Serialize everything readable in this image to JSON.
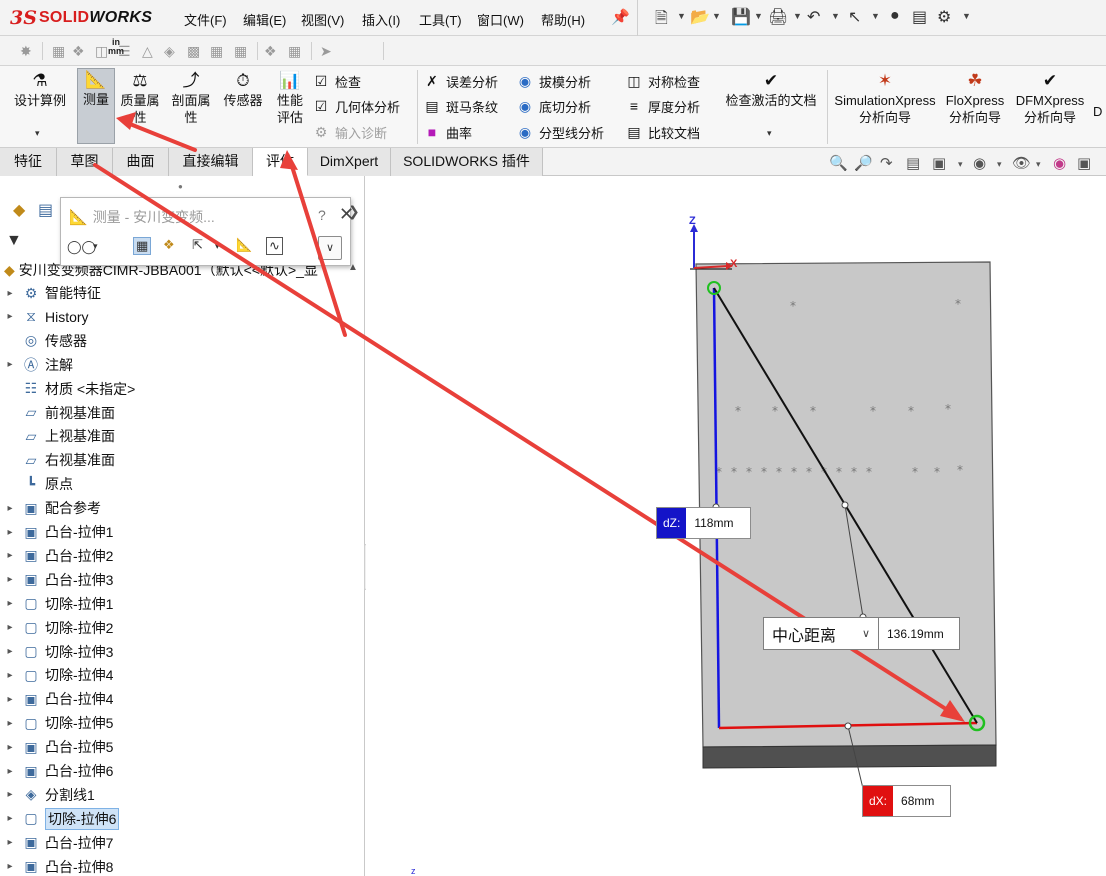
{
  "app": {
    "logo_prefix": "3S",
    "logo_solid": "SOLID",
    "logo_works": "WORKS"
  },
  "menu": [
    {
      "label": "文件(F)"
    },
    {
      "label": "编辑(E)"
    },
    {
      "label": "视图(V)"
    },
    {
      "label": "插入(I)"
    },
    {
      "label": "工具(T)"
    },
    {
      "label": "窗口(W)"
    },
    {
      "label": "帮助(H)"
    }
  ],
  "ribbon": {
    "design_study": "设计算例",
    "measure": "测量",
    "mass_props_line1": "质量属",
    "mass_props_line2": "性",
    "section_props_line1": "剖面属",
    "section_props_line2": "性",
    "sensor": "传感器",
    "perf_eval_line1": "性能",
    "perf_eval_line2": "评估",
    "check": "检查",
    "geometry_analysis": "几何体分析",
    "import_diagnostics": "输入诊断",
    "deviation_analysis": "误差分析",
    "zebra_stripes": "斑马条纹",
    "curvature": "曲率",
    "draft_analysis": "拔模分析",
    "undercut_analysis": "底切分析",
    "parting_line_analysis": "分型线分析",
    "symmetry_check": "对称检查",
    "thickness_analysis": "厚度分析",
    "compare_documents": "比较文档",
    "check_active_document": "检查激活的文档",
    "simxpress_line1": "SimulationXpress",
    "simxpress_line2": "分析向导",
    "floxpress_line1": "FloXpress",
    "floxpress_line2": "分析向导",
    "dfmxpress_line1": "DFMXpress",
    "dfmxpress_line2": "分析向导",
    "cut_off": "D"
  },
  "tabs": [
    {
      "label": "特征"
    },
    {
      "label": "草图"
    },
    {
      "label": "曲面"
    },
    {
      "label": "直接编辑"
    },
    {
      "label": "评估"
    },
    {
      "label": "DimXpert"
    },
    {
      "label": "SOLIDWORKS 插件"
    }
  ],
  "measure_popup": {
    "title": "测量 - 安川变变频...",
    "help": "?",
    "units_top": "in",
    "units_bottom": "mm"
  },
  "tree": {
    "root": "安川变变频器CIMR-JBBA001（默认<<默认>_显",
    "items": [
      {
        "label": "智能特征",
        "expandable": true
      },
      {
        "label": "History",
        "expandable": true
      },
      {
        "label": "传感器",
        "expandable": false
      },
      {
        "label": "注解",
        "expandable": true
      },
      {
        "label": "材质 <未指定>",
        "expandable": false
      },
      {
        "label": "前视基准面",
        "expandable": false
      },
      {
        "label": "上视基准面",
        "expandable": false
      },
      {
        "label": "右视基准面",
        "expandable": false
      },
      {
        "label": "原点",
        "expandable": false
      },
      {
        "label": "配合参考",
        "expandable": true
      },
      {
        "label": "凸台-拉伸1",
        "expandable": true
      },
      {
        "label": "凸台-拉伸2",
        "expandable": true
      },
      {
        "label": "凸台-拉伸3",
        "expandable": true
      },
      {
        "label": "切除-拉伸1",
        "expandable": true
      },
      {
        "label": "切除-拉伸2",
        "expandable": true
      },
      {
        "label": "切除-拉伸3",
        "expandable": true
      },
      {
        "label": "切除-拉伸4",
        "expandable": true
      },
      {
        "label": "凸台-拉伸4",
        "expandable": true
      },
      {
        "label": "切除-拉伸5",
        "expandable": true
      },
      {
        "label": "凸台-拉伸5",
        "expandable": true
      },
      {
        "label": "凸台-拉伸6",
        "expandable": true
      },
      {
        "label": "分割线1",
        "expandable": true
      },
      {
        "label": "切除-拉伸6",
        "expandable": true,
        "selected": true
      },
      {
        "label": "凸台-拉伸7",
        "expandable": true
      },
      {
        "label": "凸台-拉伸8",
        "expandable": true
      }
    ]
  },
  "measurements": {
    "dz_key": "dZ:",
    "dz_value": "118mm",
    "dx_key": "dX:",
    "dx_value": "68mm",
    "center_label": "中心距离",
    "center_value": "136.19mm"
  },
  "triad": {
    "z": "Z",
    "x": "X"
  },
  "small_triad_z": "z",
  "colors": {
    "accent_red": "#e8403a",
    "dz_blue": "#1414c8",
    "dx_red": "#e01010",
    "brand_red": "#d81e1e",
    "part_gray": "#c8c8c8"
  },
  "icons": {
    "pin": "pin-icon",
    "measure": "measure-icon",
    "filter": "filter-icon"
  }
}
